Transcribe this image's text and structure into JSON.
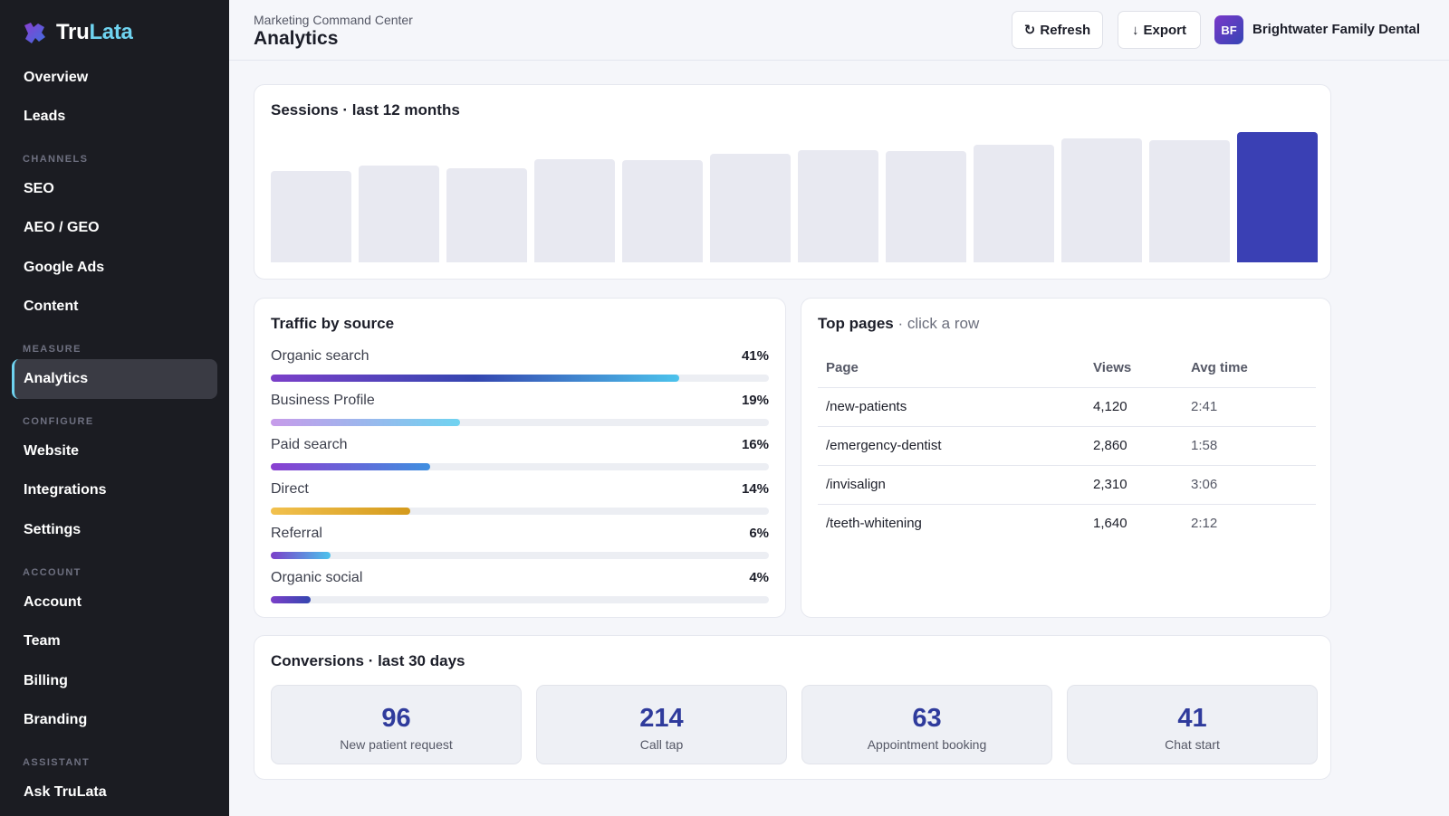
{
  "brand": {
    "name_part1": "Tru",
    "name_part2": "Lata",
    "accent": "#6fd3f0"
  },
  "sidebar": {
    "items": [
      {
        "label": "Overview",
        "active": false
      },
      {
        "label": "Leads",
        "active": false
      },
      {
        "label": "SEO",
        "active": false
      },
      {
        "label": "AEO / GEO",
        "active": false
      },
      {
        "label": "Google Ads",
        "active": false
      },
      {
        "label": "Content",
        "active": false
      },
      {
        "label": "Analytics",
        "active": true
      },
      {
        "label": "Website",
        "active": false
      },
      {
        "label": "Integrations",
        "active": false
      },
      {
        "label": "Settings",
        "active": false
      },
      {
        "label": "Account",
        "active": false
      },
      {
        "label": "Team",
        "active": false
      },
      {
        "label": "Billing",
        "active": false
      },
      {
        "label": "Branding",
        "active": false
      },
      {
        "label": "Ask TruLata",
        "active": false
      }
    ],
    "sections": [
      "CHANNELS",
      "MEASURE",
      "CONFIGURE",
      "ACCOUNT",
      "ASSISTANT"
    ]
  },
  "header": {
    "breadcrumb": "Marketing Command Center",
    "title": "Analytics",
    "refresh_label": "Refresh",
    "export_label": "Export",
    "refresh_icon": "refresh-icon",
    "export_icon": "arrow-down-icon",
    "org_initials": "BF",
    "org_name": "Brightwater Family Dental"
  },
  "sessions": {
    "title": "Sessions · last 12 months",
    "bar_color": "#e8e9f1",
    "highlight_color": "#3a40b4",
    "chart_data": {
      "type": "bar",
      "categories": [],
      "values": [
        71,
        75,
        73,
        80,
        79,
        84,
        87,
        86,
        91,
        96,
        95,
        101
      ],
      "highlight_index": 11,
      "ylim": [
        0,
        101
      ],
      "grid": false,
      "legend": "none"
    }
  },
  "traffic": {
    "title": "Traffic by source",
    "sources": [
      {
        "label": "Organic search",
        "pct_text": "41%",
        "fill_fraction": 0.82,
        "gradient": [
          "#7b3fc9",
          "#3446b0",
          "#4cc3ec"
        ]
      },
      {
        "label": "Business Profile",
        "pct_text": "19%",
        "fill_fraction": 0.38,
        "gradient": [
          "#c79bea",
          "#6fd3f0"
        ]
      },
      {
        "label": "Paid search",
        "pct_text": "16%",
        "fill_fraction": 0.32,
        "gradient": [
          "#8a3fd1",
          "#3f8fe0"
        ]
      },
      {
        "label": "Direct",
        "pct_text": "14%",
        "fill_fraction": 0.28,
        "gradient": [
          "#f2c14e",
          "#d49a1c"
        ]
      },
      {
        "label": "Referral",
        "pct_text": "6%",
        "fill_fraction": 0.12,
        "gradient": [
          "#7b3fc9",
          "#4cc3ec"
        ]
      },
      {
        "label": "Organic social",
        "pct_text": "4%",
        "fill_fraction": 0.08,
        "gradient": [
          "#7b3fc9",
          "#3446b0"
        ]
      }
    ]
  },
  "top_pages": {
    "title": "Top pages",
    "subtitle": "· click a row",
    "columns": [
      "Page",
      "Views",
      "Avg time"
    ],
    "rows": [
      {
        "page": "/new-patients",
        "views": "4,120",
        "avg_time": "2:41"
      },
      {
        "page": "/emergency-dentist",
        "views": "2,860",
        "avg_time": "1:58"
      },
      {
        "page": "/invisalign",
        "views": "2,310",
        "avg_time": "3:06"
      },
      {
        "page": "/teeth-whitening",
        "views": "1,640",
        "avg_time": "2:12"
      }
    ]
  },
  "conversions": {
    "title": "Conversions · last 30 days",
    "items": [
      {
        "value": "96",
        "label": "New patient request"
      },
      {
        "value": "214",
        "label": "Call tap"
      },
      {
        "value": "63",
        "label": "Appointment booking"
      },
      {
        "value": "41",
        "label": "Chat start"
      }
    ]
  }
}
